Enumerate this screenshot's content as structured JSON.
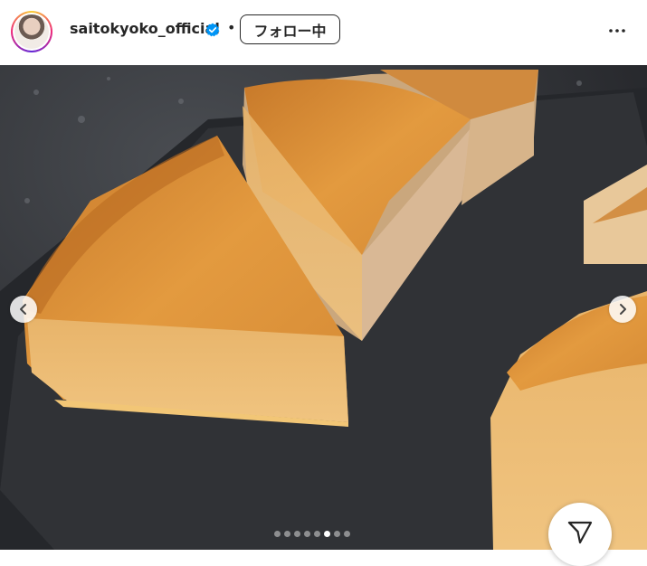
{
  "post": {
    "username": "saitokyoko_official",
    "verified": true,
    "separator": "•",
    "follow_label": "フォロー中"
  },
  "icons": {
    "avatar": "profile-photo",
    "verified": "verified-badge-icon",
    "more": "more-options-icon",
    "prev": "chevron-left-icon",
    "next": "chevron-right-icon",
    "share": "send-icon"
  },
  "carousel": {
    "total": 8,
    "current": 5
  },
  "colors": {
    "verified_blue": "#0095f6",
    "text": "#262626"
  }
}
